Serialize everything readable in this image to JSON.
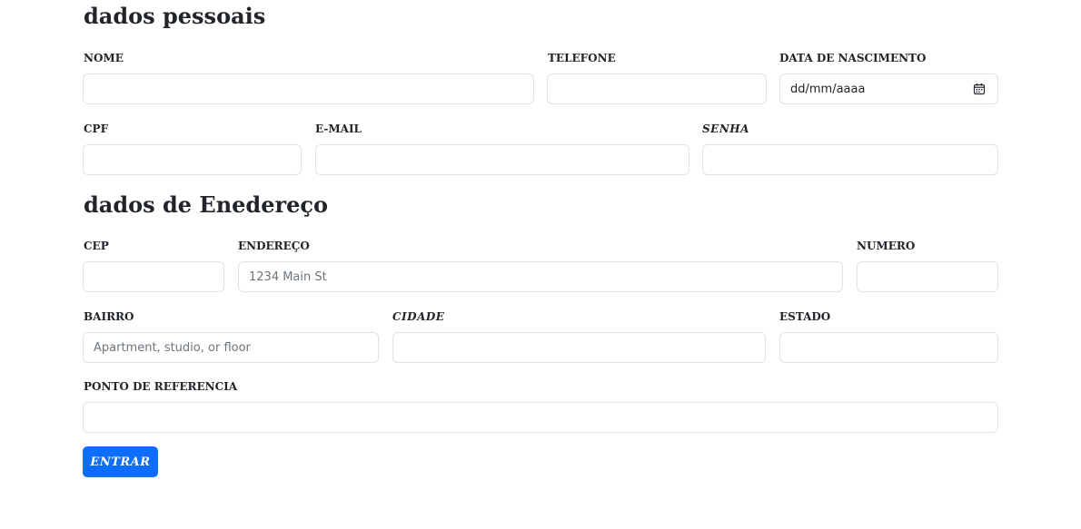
{
  "personal": {
    "title": "dados pessoais",
    "nome_label": "NOME",
    "telefone_label": "TELEFONE",
    "nascimento_label": "DATA DE NASCIMENTO",
    "nascimento_value": "dd/mm/aaaa",
    "cpf_label": "CPF",
    "email_label": "E-MAIL",
    "senha_label": "SENHA"
  },
  "address": {
    "title": "dados de Enedereço",
    "cep_label": "CEP",
    "endereco_label": "ENDEREÇO",
    "endereco_placeholder": "1234 Main St",
    "numero_label": "NUMERO",
    "bairro_label": "BAIRRO",
    "bairro_placeholder": "Apartment, studio, or floor",
    "cidade_label": "CIDADE",
    "estado_label": "ESTADO",
    "referencia_label": "PONTO DE REFERENCIA"
  },
  "submit": {
    "label": "ENTRAR"
  },
  "icons": {
    "date_picker": "calendar-icon"
  },
  "colors": {
    "primary": "#0d6efd",
    "border": "#dee2e6",
    "text": "#212529",
    "placeholder": "#6c757d"
  }
}
